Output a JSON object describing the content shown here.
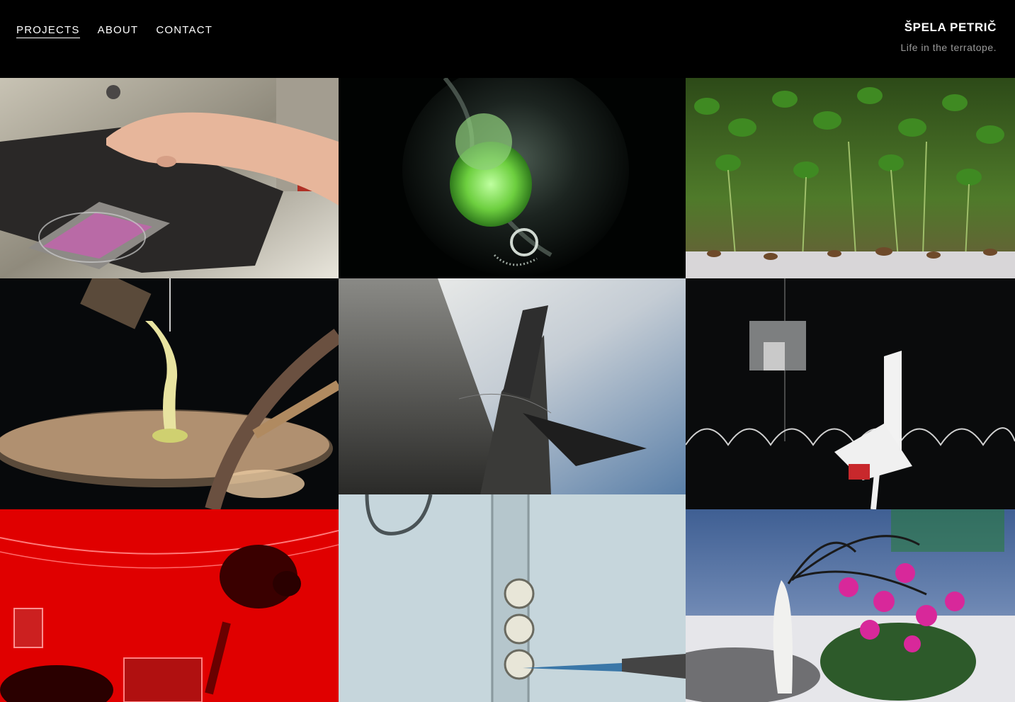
{
  "nav": {
    "items": [
      {
        "label": "PROJECTS",
        "active": true
      },
      {
        "label": "ABOUT",
        "active": false
      },
      {
        "label": "CONTACT",
        "active": false
      }
    ]
  },
  "brand": {
    "name": "ŠPELA PETRIČ",
    "tagline": "Life in the terratope."
  },
  "grid": {
    "tiles": [
      {
        "subject": "microscope stage with hand",
        "icon": "microscope-photo"
      },
      {
        "subject": "green plant fluorescence",
        "icon": "plant-photo"
      },
      {
        "subject": "cress sprouts",
        "icon": "sprouts-photo"
      },
      {
        "subject": "liquid pouring onto disc",
        "icon": "lab-photo"
      },
      {
        "subject": "sail over water",
        "icon": "sail-photo"
      },
      {
        "subject": "hanging device in dark",
        "icon": "installation-photo"
      },
      {
        "subject": "mouse under red light",
        "icon": "mouse-photo"
      },
      {
        "subject": "cells in capillary",
        "icon": "cells-photo"
      },
      {
        "subject": "cyclamen with wires",
        "icon": "flower-photo"
      }
    ]
  }
}
